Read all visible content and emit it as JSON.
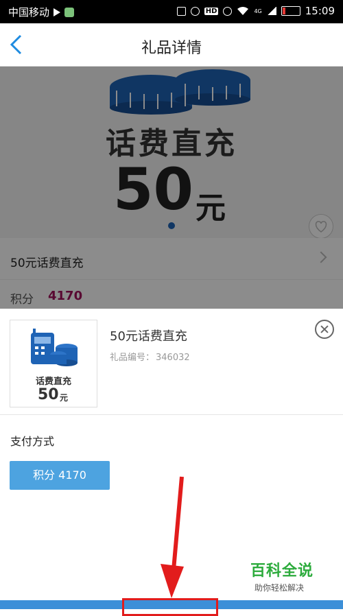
{
  "status_bar": {
    "carrier": "中国移动",
    "network": "4G",
    "time": "15:09"
  },
  "nav": {
    "title": "礼品详情"
  },
  "banner": {
    "line1": "话费直充",
    "amount": "50",
    "unit": "元"
  },
  "product": {
    "name": "50元话费直充",
    "points_label": "积分",
    "points_value": "4170"
  },
  "sheet": {
    "thumb_label": "话费直充",
    "thumb_amount": "50",
    "thumb_unit": "元",
    "gift_name": "50元话费直充",
    "gift_code_label": "礼品编号：",
    "gift_code": "346032",
    "pay_label": "支付方式",
    "pay_button": "积分 4170"
  },
  "watermark": {
    "title": "百科全说",
    "subtitle": "助你轻松解决"
  }
}
